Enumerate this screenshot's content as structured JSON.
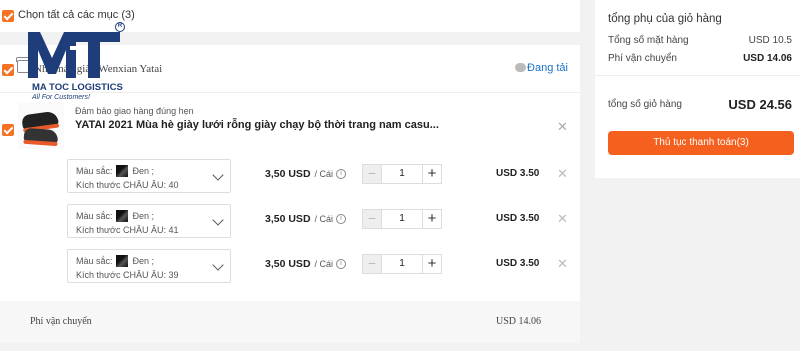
{
  "select_all": {
    "label": "Chọn tất cả các mục (3)"
  },
  "store": {
    "name": "Nhà máy giày Wenxian Yatai",
    "upload_label": "Đang tải",
    "product": {
      "guarantee": "Đảm bảo giao hàng đúng hẹn",
      "title": "YATAI 2021 Mùa hè giày lưới rỗng giày chạy bộ thời trang nam casu...",
      "variants": [
        {
          "color_label": "Màu sắc:",
          "color_value": "Đen ;",
          "size_label": "Kích thước CHÂU ÂU:",
          "size_value": "40",
          "size_text": "Kích thước CHÂU ÂU: 40",
          "unit_price": "3,50 USD",
          "unit": "/ Cái",
          "quantity": "1",
          "total": "USD 3.50"
        },
        {
          "color_label": "Màu sắc:",
          "color_value": "Đen ;",
          "size_label": "Kích thước CHÂU ÂU:",
          "size_value": "41",
          "size_text": "Kích thước CHÂU ÂU: 41",
          "unit_price": "3,50 USD",
          "unit": "/ Cái",
          "quantity": "1",
          "total": "USD 3.50"
        },
        {
          "color_label": "Màu sắc:",
          "color_value": "Đen ;",
          "size_label": "Kích thước CHÂU ÂU:",
          "size_value": "39",
          "size_text": "Kích thước CHÂU ÂU: 39",
          "unit_price": "3,50 USD",
          "unit": "/ Cái",
          "quantity": "1",
          "total": "USD 3.50"
        }
      ]
    },
    "shipping_label": "Phí vận chuyển",
    "shipping_value": "USD 14.06"
  },
  "summary": {
    "title": "tổng phụ của giỏ hàng",
    "items_label": "Tổng số mặt hàng",
    "items_value": "USD 10.5",
    "shipping_label": "Phí vận chuyển",
    "shipping_value": "USD 14.06",
    "total_label": "tổng số giỏ hàng",
    "total_value": "USD 24.56",
    "checkout_label": "Thủ tục thanh toán(3)"
  },
  "watermark": {
    "brand": "MA TOC LOGISTICS",
    "slogan": "All For Customers!"
  },
  "colors": {
    "accent": "#f57224",
    "checkout": "#f5601e",
    "link": "#1a73c9",
    "brand": "#1f3d7a"
  },
  "icons": [
    "checkbox-checked-icon",
    "shop-icon",
    "cloud-icon",
    "chevron-down-icon",
    "info-icon",
    "minus-icon",
    "plus-icon",
    "close-icon"
  ]
}
